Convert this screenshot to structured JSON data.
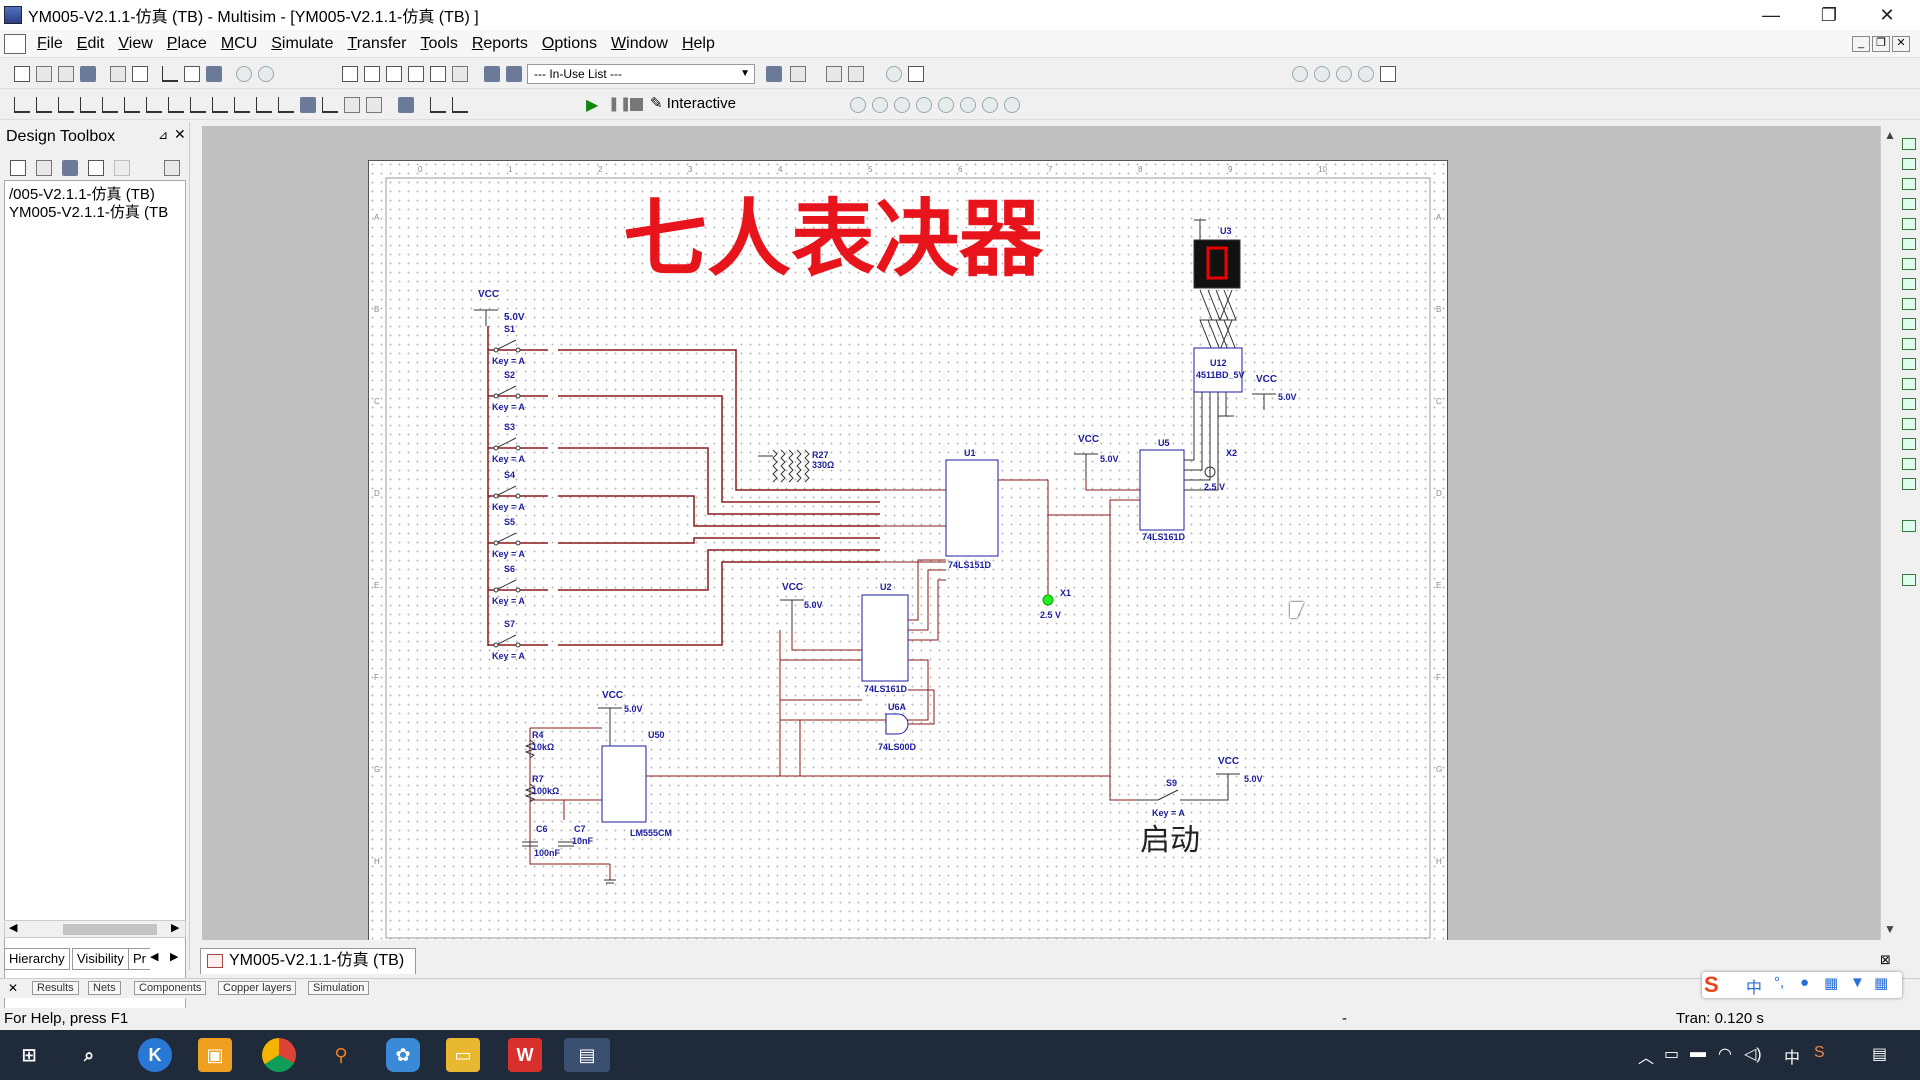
{
  "window": {
    "title": "YM005-V2.1.1-仿真  (TB)   - Multisim - [YM005-V2.1.1-仿真  (TB) ]",
    "minimize": "—",
    "restore": "❐",
    "close": "✕"
  },
  "menu": [
    "File",
    "Edit",
    "View",
    "Place",
    "MCU",
    "Simulate",
    "Transfer",
    "Tools",
    "Reports",
    "Options",
    "Window",
    "Help"
  ],
  "mdi": {
    "minimize": "_",
    "restore": "❐",
    "close": "✕"
  },
  "toolbar": {
    "inuse_list": "--- In-Use List ---",
    "interactive": "Interactive"
  },
  "toolbox": {
    "title": "Design Toolbox",
    "items": [
      "/005-V2.1.1-仿真  (TB)",
      "YM005-V2.1.1-仿真  (TB"
    ],
    "tabs": [
      "Hierarchy",
      "Visibility",
      "Pr"
    ]
  },
  "document_tab": "YM005-V2.1.1-仿真  (TB)",
  "bottom_tabs": [
    "Results",
    "Nets",
    "Components",
    "Copper layers",
    "Simulation"
  ],
  "status": {
    "left": "For Help, press F1",
    "middle": "-",
    "tran": "Tran: 0.120 s"
  },
  "schematic": {
    "title": "七人表决器",
    "start_label": "启动",
    "ruler_top": [
      "0",
      "1",
      "2",
      "3",
      "4",
      "5",
      "6",
      "7",
      "8",
      "9",
      "10"
    ],
    "ruler_side": [
      "A",
      "B",
      "C",
      "D",
      "E",
      "F",
      "G",
      "H"
    ],
    "vcc": "VCC",
    "v5": "5.0V",
    "switches": [
      {
        "name": "S1",
        "key": "Key = A"
      },
      {
        "name": "S2",
        "key": "Key = A"
      },
      {
        "name": "S3",
        "key": "Key = A"
      },
      {
        "name": "S4",
        "key": "Key = A"
      },
      {
        "name": "S5",
        "key": "Key = A"
      },
      {
        "name": "S6",
        "key": "Key = A"
      },
      {
        "name": "S7",
        "key": "Key = A"
      }
    ],
    "r27": {
      "name": "R27",
      "value": "330Ω"
    },
    "u1": {
      "name": "U1",
      "part": "74LS151D"
    },
    "u2": {
      "name": "U2",
      "part": "74LS161D"
    },
    "u5": {
      "name": "U5",
      "part": "74LS161D"
    },
    "u6a": {
      "name": "U6A",
      "part": "74LS00D"
    },
    "u3": {
      "name": "U3"
    },
    "u12": {
      "name": "U12",
      "part": "4511BD_5V"
    },
    "u50": {
      "name": "U50",
      "part": "LM555CM"
    },
    "x1": {
      "name": "X1",
      "volt": "2.5 V"
    },
    "x2": {
      "name": "X2",
      "volt": "2.5 V"
    },
    "s9": {
      "name": "S9",
      "key": "Key = A"
    },
    "r4": {
      "name": "R4",
      "value": "10kΩ"
    },
    "r7": {
      "name": "R7",
      "value": "100kΩ"
    },
    "c6": {
      "name": "C6",
      "value": "100nF"
    },
    "c7": {
      "name": "C7",
      "value": "10nF"
    }
  },
  "taskbar": {
    "clock_ime": "中",
    "apps": [
      "start",
      "search",
      "k",
      "app-orange",
      "chrome",
      "search-orange",
      "app-blue",
      "folder",
      "wps",
      "multisim"
    ]
  },
  "colors": {
    "title_red": "#e8141c",
    "wire": "#8b1a1a",
    "part_blue": "#1c1c9c",
    "taskbar": "#1f2a3a"
  }
}
